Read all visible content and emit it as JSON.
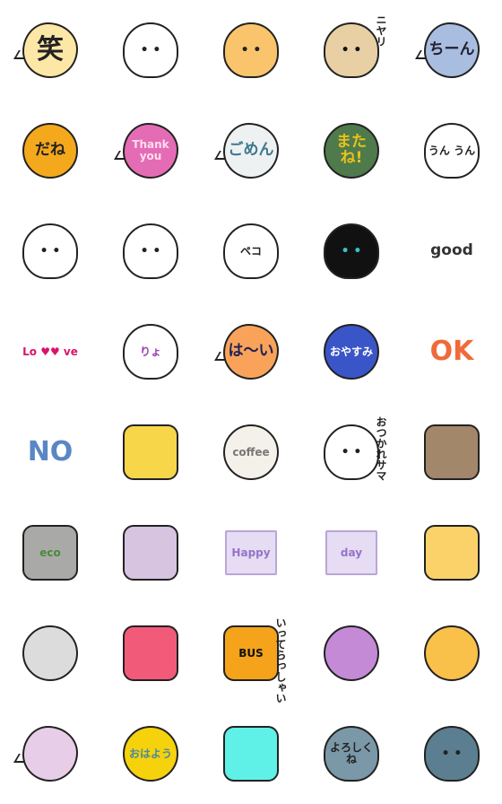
{
  "stickers": [
    {
      "name": "laugh-bubble",
      "text": "笑",
      "shape": "blob",
      "bg": "#fde7a6",
      "fg": "#222",
      "size": "big"
    },
    {
      "name": "girl-with-bow",
      "text": "",
      "shape": "face",
      "bg": "#fff",
      "fg": "#222",
      "accent": "#b77c2c"
    },
    {
      "name": "grinning-cat",
      "text": "",
      "shape": "face",
      "bg": "#f9c46b",
      "fg": "#222"
    },
    {
      "name": "smirk-dog-sunglasses",
      "text": "",
      "side": "ニヤリ",
      "shape": "face",
      "bg": "#e8cfa4",
      "fg": "#111"
    },
    {
      "name": "chiin-bubble",
      "text": "ちーん",
      "shape": "blob",
      "bg": "#a9bde0",
      "fg": "#223",
      "size": "mid"
    },
    {
      "name": "dane-bubble",
      "text": "だね",
      "shape": "circle",
      "bg": "#f4a81c",
      "fg": "#222",
      "size": "mid"
    },
    {
      "name": "thank-you-bubble",
      "text": "Thank\nyou",
      "shape": "blob",
      "bg": "#e46cb4",
      "fg": "#fde",
      "size": "small"
    },
    {
      "name": "gomen-bubble",
      "text": "ごめん",
      "shape": "blob",
      "bg": "#eef1f2",
      "fg": "#3e7890",
      "size": "mid"
    },
    {
      "name": "matane-bubble",
      "text": "またね!",
      "shape": "circle",
      "bg": "#4f7a4b",
      "fg": "#e8c21a",
      "size": "mid"
    },
    {
      "name": "nodding-dog",
      "text": "うん うん",
      "shape": "face",
      "bg": "#fff",
      "fg": "#222",
      "size": "small"
    },
    {
      "name": "white-cat-pointing",
      "text": "",
      "shape": "face",
      "bg": "#fff",
      "fg": "#222",
      "accent": "#9b3fb0"
    },
    {
      "name": "white-cat-sweating",
      "text": "",
      "shape": "face",
      "bg": "#fff",
      "fg": "#222",
      "accent": "#9b3fb0"
    },
    {
      "name": "bowing-person",
      "text": "ペコ",
      "shape": "face",
      "bg": "#fff",
      "fg": "#222",
      "accent": "#6b8590",
      "size": "small"
    },
    {
      "name": "black-cat-angry",
      "text": "",
      "shape": "face",
      "bg": "#111",
      "fg": "#40c0c0"
    },
    {
      "name": "good-text",
      "text": "good",
      "shape": "none",
      "bg": "#fff",
      "fg": "#333",
      "size": "mid"
    },
    {
      "name": "love-text",
      "text": "Lo ♥♥ ve",
      "shape": "none",
      "bg": "#fff",
      "fg": "#d8146a",
      "size": "small"
    },
    {
      "name": "cat-ryo",
      "text": "りょ",
      "shape": "face",
      "bg": "#fff",
      "fg": "#9b3fb0",
      "size": "small"
    },
    {
      "name": "hai-bubble",
      "text": "は〜い",
      "shape": "blob",
      "bg": "#f9a35a",
      "fg": "#225",
      "size": "mid"
    },
    {
      "name": "oyasumi-bubble",
      "text": "おやすみ",
      "shape": "circle",
      "bg": "#3a55c8",
      "fg": "#fff",
      "size": "small"
    },
    {
      "name": "ok-text",
      "text": "OK",
      "shape": "none",
      "bg": "#fff",
      "fg": "#f06a3a",
      "size": "big"
    },
    {
      "name": "no-text",
      "text": "NO",
      "shape": "none",
      "bg": "#fff",
      "fg": "#5a86c6",
      "size": "big"
    },
    {
      "name": "beer-mug",
      "text": "",
      "shape": "rounded",
      "bg": "#f7d64a",
      "fg": "#222"
    },
    {
      "name": "coffee-cup",
      "text": "coffee",
      "shape": "circle",
      "bg": "#f4f1ea",
      "fg": "#777",
      "size": "small"
    },
    {
      "name": "cat-otsukaresama",
      "text": "",
      "side": "おつかれサマ",
      "shape": "face",
      "bg": "#fff",
      "fg": "#222"
    },
    {
      "name": "muffin",
      "text": "",
      "shape": "rounded",
      "bg": "#a3876a",
      "fg": "#222"
    },
    {
      "name": "eco-bag",
      "text": "eco",
      "shape": "rounded",
      "bg": "#a9aaa8",
      "fg": "#4a8a3a",
      "size": "small"
    },
    {
      "name": "mirror",
      "text": "",
      "shape": "rounded",
      "bg": "#d6c4e0",
      "fg": "#222"
    },
    {
      "name": "happy-flag",
      "text": "Happy",
      "shape": "flag",
      "bg": "#e6dcf4",
      "fg": "#9474c6",
      "size": "small"
    },
    {
      "name": "day-flag",
      "text": "day",
      "shape": "flag",
      "bg": "#e6dcf4",
      "fg": "#9474c6",
      "size": "small"
    },
    {
      "name": "birthday-cake",
      "text": "",
      "shape": "rounded",
      "bg": "#fbd26a",
      "fg": "#222"
    },
    {
      "name": "diamond-ring",
      "text": "",
      "shape": "circle",
      "bg": "#dcdcdc",
      "fg": "#e83a6a"
    },
    {
      "name": "red-car",
      "text": "",
      "shape": "rounded",
      "bg": "#f25a7a",
      "fg": "#222"
    },
    {
      "name": "bus",
      "text": "BUS",
      "side": "いってらっしゃい",
      "shape": "rounded",
      "bg": "#f4a31a",
      "fg": "#111",
      "size": "small"
    },
    {
      "name": "purple-flower",
      "text": "",
      "shape": "circle",
      "bg": "#c48ad6",
      "fg": "#8aa070"
    },
    {
      "name": "yellow-flower",
      "text": "",
      "shape": "circle",
      "bg": "#f9c04a",
      "fg": "#456"
    },
    {
      "name": "bouquet",
      "text": "",
      "shape": "blob",
      "bg": "#e8cde8",
      "fg": "#a36a9a"
    },
    {
      "name": "ohayou-girl",
      "text": "おはよう",
      "shape": "circle",
      "bg": "#f5d20c",
      "fg": "#4a8aa0",
      "size": "small"
    },
    {
      "name": "sailboat",
      "text": "",
      "shape": "rounded",
      "bg": "#5ff0e8",
      "fg": "#222"
    },
    {
      "name": "yoroshiku-boy",
      "text": "よろしくね",
      "shape": "face",
      "bg": "#7a98a8",
      "fg": "#222",
      "size": "small"
    },
    {
      "name": "masked-boy",
      "text": "",
      "shape": "face",
      "bg": "#5b7f90",
      "fg": "#222"
    }
  ]
}
